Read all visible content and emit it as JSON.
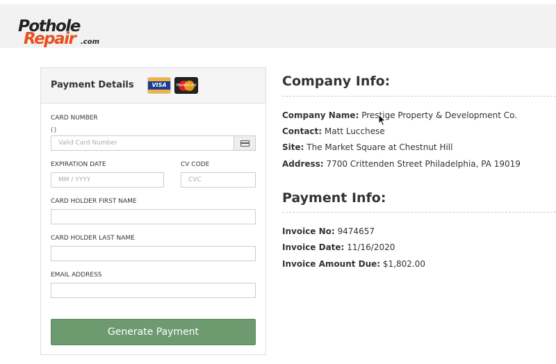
{
  "brand": {
    "logo_line1": "Pothole",
    "logo_line2": "Repair",
    "logo_suffix": ".com",
    "accent_color": "#e8501e"
  },
  "payment_form": {
    "title": "Payment Details",
    "card_icons": [
      "visa-icon",
      "mastercard-icon"
    ],
    "visa_text": "VISA",
    "mastercard_text": "MasterCard",
    "card_number": {
      "label": "CARD NUMBER",
      "hint": "{}",
      "placeholder": "Valid Card Number",
      "value": ""
    },
    "expiration": {
      "label": "EXPIRATION DATE",
      "placeholder": "MM / YYYY",
      "value": ""
    },
    "cvc": {
      "label": "CV CODE",
      "placeholder": "CVC",
      "value": ""
    },
    "first_name": {
      "label": "CARD HOLDER FIRST NAME",
      "value": ""
    },
    "last_name": {
      "label": "CARD HOLDER LAST NAME",
      "value": ""
    },
    "email": {
      "label": "EMAIL ADDRESS",
      "value": ""
    },
    "submit_label": "Generate Payment",
    "button_color": "#6e9a70"
  },
  "company_info": {
    "title": "Company Info:",
    "rows": [
      {
        "label": "Company Name:",
        "value": "Prestige Property & Development Co."
      },
      {
        "label": "Contact:",
        "value": "Matt Lucchese"
      },
      {
        "label": "Site:",
        "value": "The Market Square at Chestnut Hill"
      },
      {
        "label": "Address:",
        "value": "7700 Crittenden Street Philadelphia, PA 19019"
      }
    ]
  },
  "payment_info": {
    "title": "Payment Info:",
    "rows": [
      {
        "label": "Invoice No:",
        "value": "9474657"
      },
      {
        "label": "Invoice Date:",
        "value": "11/16/2020"
      },
      {
        "label": "Invoice Amount Due:",
        "value": "$1,802.00"
      }
    ]
  }
}
